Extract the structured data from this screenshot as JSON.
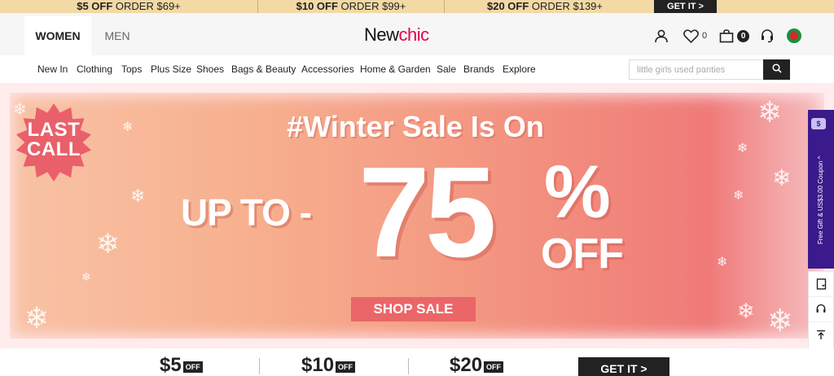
{
  "promo_strip": {
    "items": [
      {
        "amount": "$5 OFF",
        "condition": "ORDER $69+"
      },
      {
        "amount": "$10 OFF",
        "condition": "ORDER $99+"
      },
      {
        "amount": "$20 OFF",
        "condition": "ORDER $139+"
      }
    ],
    "cta": "GET IT >"
  },
  "header": {
    "tabs": [
      {
        "label": "WOMEN",
        "active": true
      },
      {
        "label": "MEN",
        "active": false
      }
    ],
    "logo": {
      "part1": "New",
      "part2": "chic"
    },
    "wishlist_count": "0",
    "cart_count": "0",
    "icons": [
      "user-icon",
      "heart-icon",
      "cart-icon",
      "headset-icon",
      "flag-icon"
    ]
  },
  "nav": {
    "items": [
      "New In",
      "Clothing",
      "Tops",
      "Plus Size",
      "Shoes",
      "Bags & Beauty",
      "Accessories",
      "Home & Garden",
      "Sale",
      "Brands",
      "Explore"
    ],
    "search_placeholder": "little girls used panties"
  },
  "banner": {
    "badge_line1": "LAST",
    "badge_line2": "CALL",
    "headline": "#Winter Sale Is On",
    "up_to": "UP TO -",
    "discount_number": "75",
    "percent": "%",
    "off": "OFF",
    "button": "SHOP SALE",
    "colors": {
      "gradient_start": "#f8c3a6",
      "gradient_end": "#ef7a78",
      "button": "#ea6668"
    }
  },
  "side_bar": {
    "coupon_chip": "$",
    "coupon_text": "Free Gift & US$3.00 Coupon ^",
    "tools": [
      "app-icon",
      "headset-icon",
      "back-to-top-icon"
    ]
  },
  "coupon_strip": {
    "items": [
      {
        "amount": "$5",
        "off": "OFF"
      },
      {
        "amount": "$10",
        "off": "OFF"
      },
      {
        "amount": "$20",
        "off": "OFF"
      }
    ],
    "cta": "GET IT >"
  }
}
